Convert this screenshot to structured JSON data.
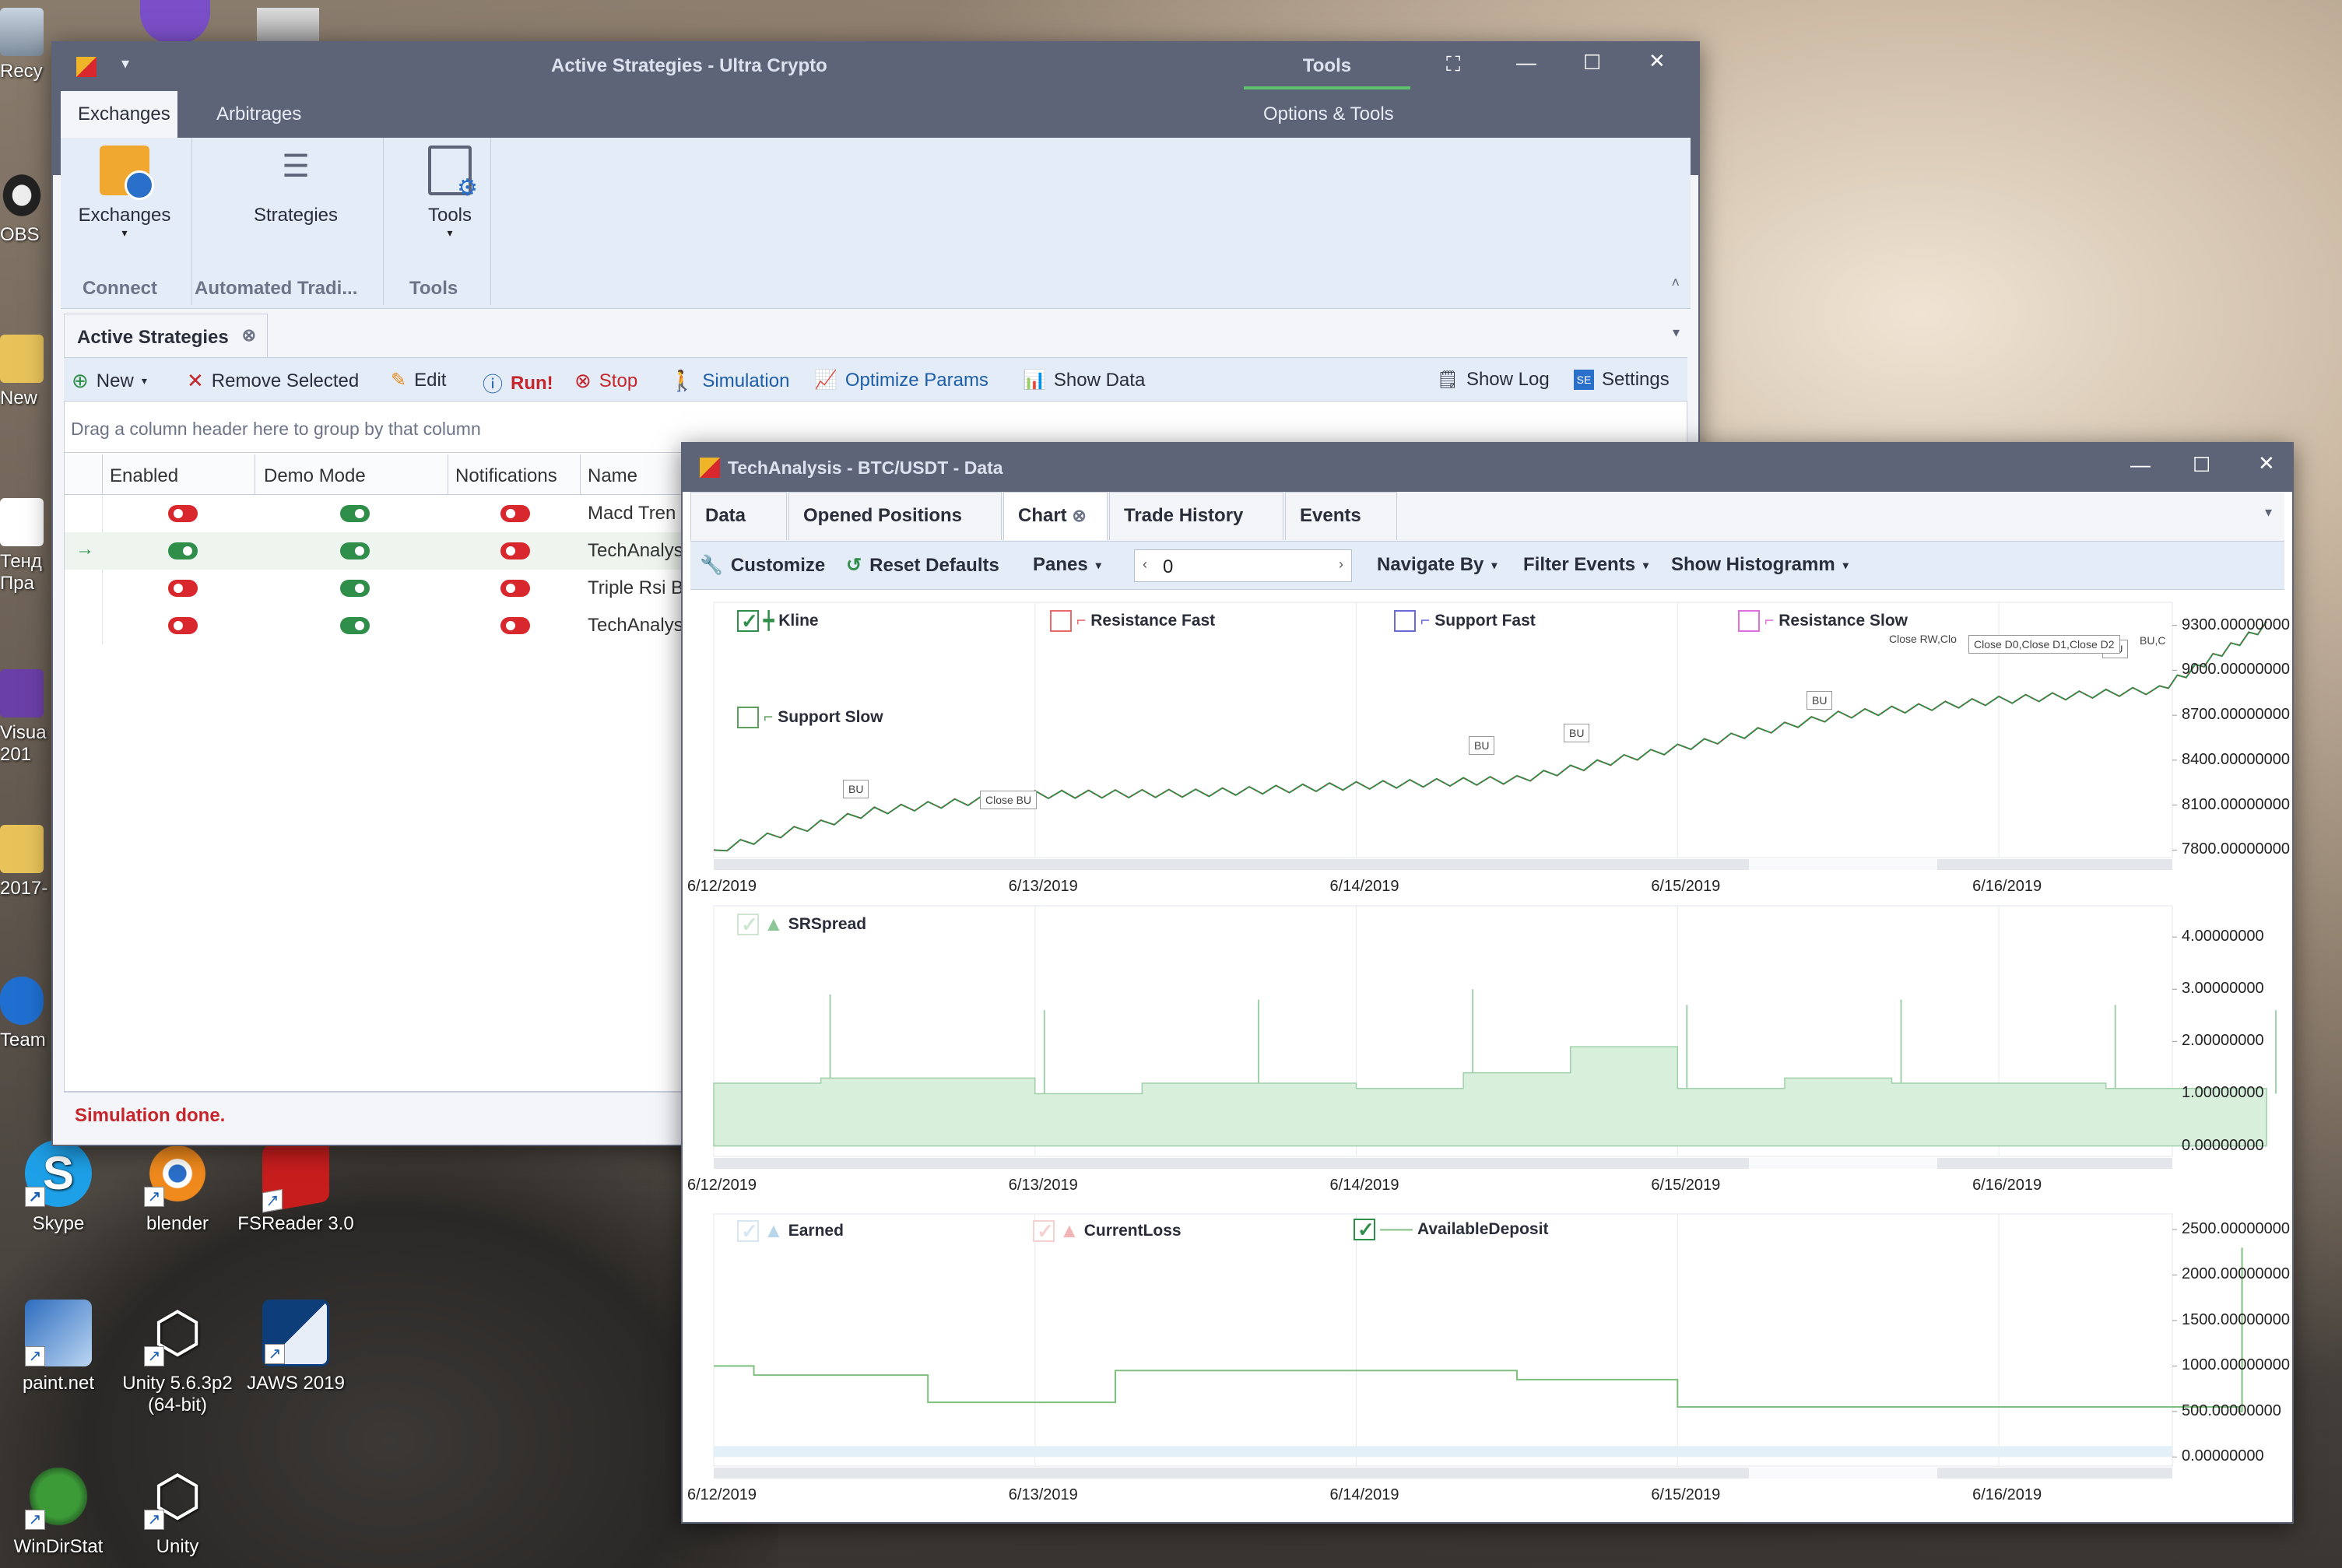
{
  "desktop": {
    "icons": [
      {
        "name": "skype",
        "label": "Skype"
      },
      {
        "name": "blender",
        "label": "blender"
      },
      {
        "name": "fsreader",
        "label": "FSReader 3.0"
      },
      {
        "name": "paintnet",
        "label": "paint.net"
      },
      {
        "name": "unity563",
        "label": "Unity 5.6.3p2 (64-bit)"
      },
      {
        "name": "jaws",
        "label": "JAWS 2019"
      },
      {
        "name": "windirstat",
        "label": "WinDirStat"
      },
      {
        "name": "unity",
        "label": "Unity"
      }
    ],
    "edge_labels": [
      "Recy",
      "OBS",
      "New",
      "Тенд Пра",
      "Visua 201",
      "2017-",
      "Team"
    ]
  },
  "main": {
    "title": "Active Strategies - Ultra Crypto",
    "context_tab": "Tools",
    "context_group": "Options & Tools",
    "ribbon_tabs": [
      "Exchanges",
      "Arbitrages"
    ],
    "ribbon_buttons": [
      {
        "label": "Exchanges",
        "icon": "exchanges-icon"
      },
      {
        "label": "Strategies",
        "icon": "strategies-icon"
      },
      {
        "label": "Tools",
        "icon": "tools-icon"
      }
    ],
    "ribbon_groups": [
      "Connect",
      "Automated Tradi...",
      "Tools"
    ],
    "doc_tab": "Active Strategies",
    "toolbar": {
      "new": "New",
      "remove": "Remove Selected",
      "edit": "Edit",
      "run": "Run!",
      "stop": "Stop",
      "simulation": "Simulation",
      "optimize": "Optimize Params",
      "show_data": "Show Data",
      "show_log": "Show Log",
      "settings": "Settings"
    },
    "group_hint": "Drag a column header here to group by that column",
    "columns": [
      "Enabled",
      "Demo Mode",
      "Notifications",
      "Name"
    ],
    "rows": [
      {
        "enabled": false,
        "demo": true,
        "notify": false,
        "name": "Macd Tren"
      },
      {
        "enabled": true,
        "demo": true,
        "notify": false,
        "name": "TechAnalys"
      },
      {
        "enabled": false,
        "demo": true,
        "notify": false,
        "name": "Triple Rsi B"
      },
      {
        "enabled": false,
        "demo": true,
        "notify": false,
        "name": "TechAnalys"
      }
    ],
    "status": "Simulation done."
  },
  "data_win": {
    "title": "TechAnalysis - BTC/USDT - Data",
    "tabs": [
      "Data",
      "Opened Positions",
      "Chart",
      "Trade History",
      "Events"
    ],
    "toolbar": {
      "customize": "Customize",
      "reset": "Reset Defaults",
      "panes": "Panes",
      "spin_value": "0",
      "navigate": "Navigate By",
      "filter": "Filter Events",
      "histogram": "Show Histogramm"
    },
    "x_dates": [
      "6/12/2019",
      "6/13/2019",
      "6/14/2019",
      "6/15/2019",
      "6/16/2019"
    ],
    "markers": [
      "BU",
      "Close BU",
      "BU",
      "BU",
      "BU",
      "BU",
      "Close RW,Clo",
      "Close D0,Close D1,Close D2",
      "BU,C"
    ]
  },
  "chart_data": [
    {
      "type": "line",
      "title": "",
      "series": [
        {
          "name": "Kline",
          "x": [
            "6/12/2019",
            "6/12/2019 12:00",
            "6/13/2019",
            "6/13/2019 12:00",
            "6/14/2019",
            "6/14/2019 12:00",
            "6/15/2019",
            "6/15/2019 12:00",
            "6/16/2019",
            "6/16/2019 12:00",
            "6/16/2019 20:00"
          ],
          "values": [
            7800,
            8060,
            8170,
            8180,
            8230,
            8270,
            8480,
            8700,
            8800,
            8870,
            9300
          ]
        },
        {
          "name": "Resistance Fast",
          "values": []
        },
        {
          "name": "Support Fast",
          "values": []
        },
        {
          "name": "Resistance Slow",
          "values": []
        },
        {
          "name": "Support Slow",
          "values": []
        }
      ],
      "yticks": [
        "9300.00000000",
        "9000.00000000",
        "8700.00000000",
        "8400.00000000",
        "8100.00000000",
        "7800.00000000"
      ],
      "ylim": [
        7750,
        9350
      ],
      "legend": "top-left",
      "grid": true
    },
    {
      "type": "area",
      "title": "",
      "series": [
        {
          "name": "SRSpread",
          "x": [
            "6/12/2019",
            "6/12/2019 08:00",
            "6/12/2019 16:00",
            "6/13/2019",
            "6/13/2019 08:00",
            "6/13/2019 16:00",
            "6/14/2019",
            "6/14/2019 08:00",
            "6/14/2019 16:00",
            "6/15/2019",
            "6/15/2019 08:00",
            "6/15/2019 16:00",
            "6/16/2019",
            "6/16/2019 08:00",
            "6/16/2019 16:00",
            "6/16/2019 20:00"
          ],
          "values": [
            1.2,
            1.3,
            1.3,
            1.0,
            1.2,
            1.2,
            1.1,
            1.4,
            1.9,
            1.1,
            1.3,
            1.2,
            1.2,
            1.1,
            1.1,
            1.0
          ]
        }
      ],
      "yticks": [
        "4.00000000",
        "3.00000000",
        "2.00000000",
        "1.00000000",
        "0.00000000"
      ],
      "ylim": [
        -0.2,
        4.3
      ],
      "legend": "top-left",
      "grid": true
    },
    {
      "type": "line",
      "title": "",
      "series": [
        {
          "name": "Earned",
          "values": []
        },
        {
          "name": "CurrentLoss",
          "values": []
        },
        {
          "name": "AvailableDeposit",
          "x": [
            "6/12/2019",
            "6/12/2019 03:00",
            "6/12/2019 16:00",
            "6/13/2019 06:00",
            "6/14/2019 12:00",
            "6/15/2019",
            "6/15/2019 16:00",
            "6/16/2019 18:00",
            "6/16/2019 18:10"
          ],
          "values": [
            1000,
            900,
            600,
            950,
            850,
            550,
            550,
            500,
            2300
          ]
        }
      ],
      "yticks": [
        "2500.00000000",
        "2000.00000000",
        "1500.00000000",
        "1000.00000000",
        "500.00000000",
        "0.00000000"
      ],
      "ylim": [
        -100,
        2500
      ],
      "legend": "top-left",
      "grid": true
    }
  ]
}
